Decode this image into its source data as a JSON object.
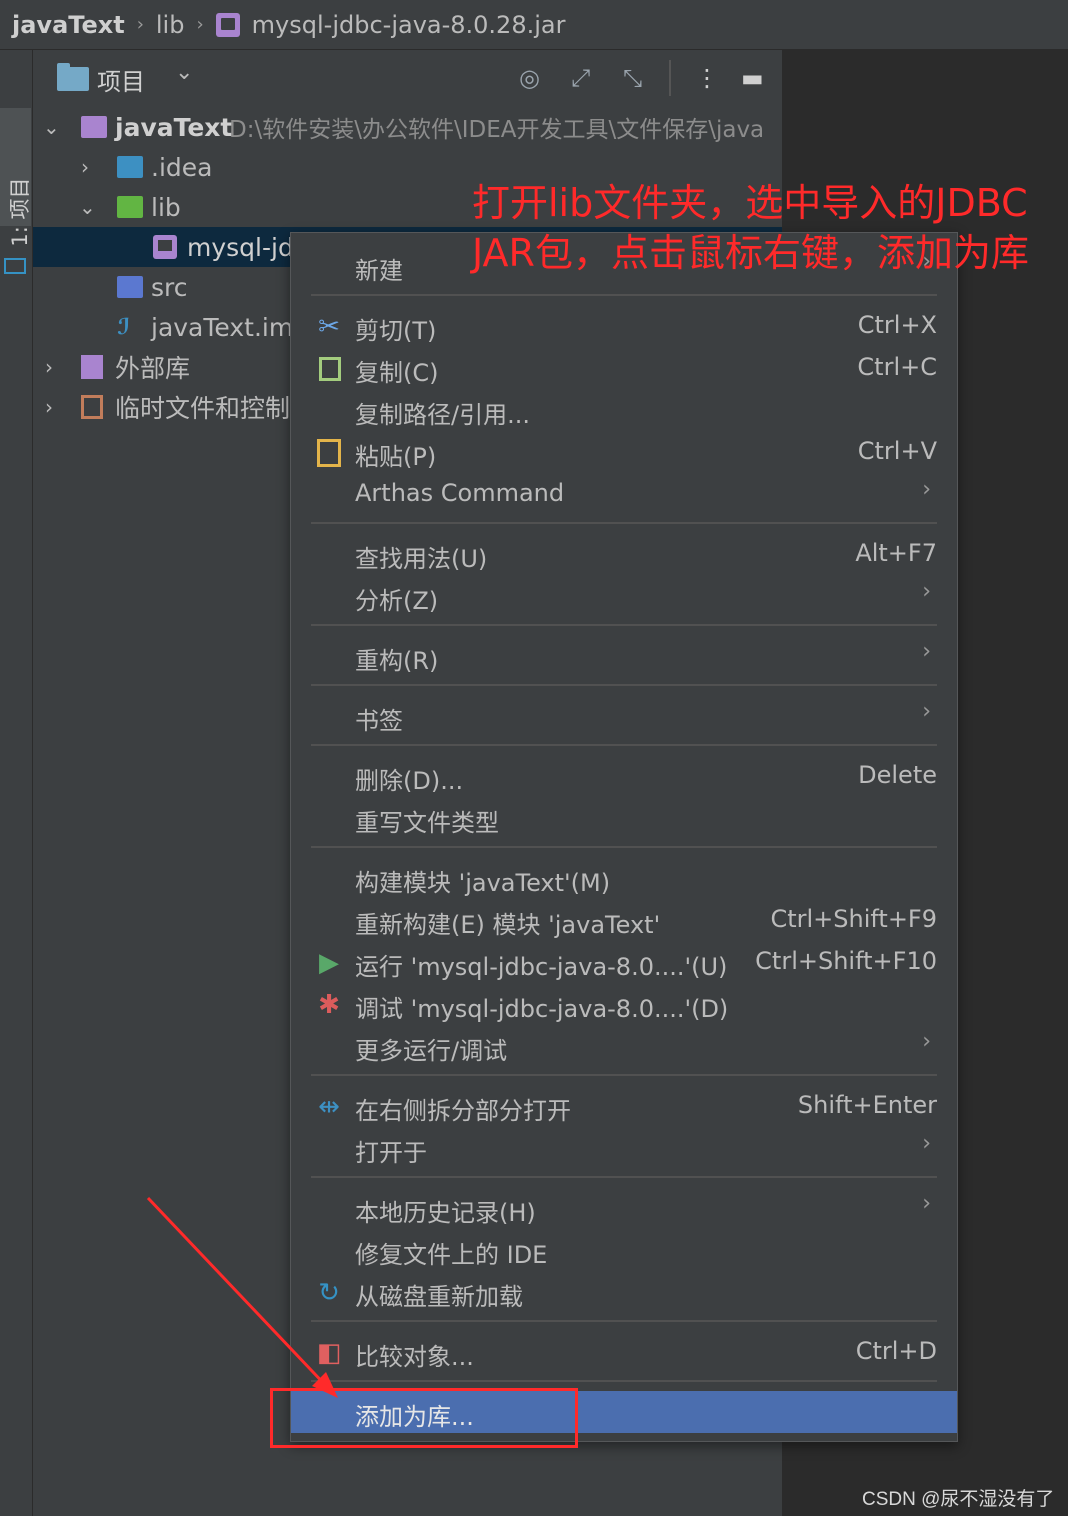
{
  "breadcrumb": {
    "project": "javaText",
    "folder": "lib",
    "file": "mysql-jdbc-java-8.0.28.jar"
  },
  "tool_stripe": {
    "label": "1: 项目"
  },
  "panel": {
    "title": "项目",
    "icons": [
      "target-icon",
      "expand-icon",
      "collapse-icon",
      "more-icon",
      "minimize-icon"
    ]
  },
  "tree": {
    "root": {
      "name": "javaText",
      "path": "D:\\软件安装\\办公软件\\IDEA开发工具\\文件保存\\java"
    },
    "idea": ".idea",
    "lib": "lib",
    "jar": "mysql-jdl",
    "src": "src",
    "iml": "javaText.iml",
    "external": "外部库",
    "scratch": "临时文件和控制台"
  },
  "menu": {
    "new": "新建",
    "cut": {
      "label": "剪切(T)",
      "shortcut": "Ctrl+X"
    },
    "copy": {
      "label": "复制(C)",
      "shortcut": "Ctrl+C"
    },
    "copy_path": "复制路径/引用...",
    "paste": {
      "label": "粘贴(P)",
      "shortcut": "Ctrl+V"
    },
    "arthas": "Arthas Command",
    "find_usages": {
      "label": "查找用法(U)",
      "shortcut": "Alt+F7"
    },
    "analyze": "分析(Z)",
    "refactor": "重构(R)",
    "bookmarks": "书签",
    "delete": {
      "label": "删除(D)...",
      "shortcut": "Delete"
    },
    "override_type": "重写文件类型",
    "build_module": "构建模块 'javaText'(M)",
    "rebuild_module": {
      "label": "重新构建(E) 模块 'javaText'",
      "shortcut": "Ctrl+Shift+F9"
    },
    "run": {
      "label": "运行 'mysql-jdbc-java-8.0....'(U)",
      "shortcut": "Ctrl+Shift+F10"
    },
    "debug": "调试 'mysql-jdbc-java-8.0....'(D)",
    "more_run": "更多运行/调试",
    "split_open": {
      "label": "在右侧拆分部分打开",
      "shortcut": "Shift+Enter"
    },
    "open_in": "打开于",
    "local_history": "本地历史记录(H)",
    "repair_ide": "修复文件上的 IDE",
    "reload": "从磁盘重新加载",
    "compare": {
      "label": "比较对象...",
      "shortcut": "Ctrl+D"
    },
    "add_as_library": "添加为库..."
  },
  "annotation": {
    "line1": "打开lib文件夹，选中导入的JDBC",
    "line2": "JAR包，点击鼠标右键，添加为库"
  },
  "watermark": "CSDN @尿不湿没有了",
  "colors": {
    "annotation": "#ff2a2a",
    "highlight": "#4b6eaf",
    "selection": "#0d293e"
  }
}
